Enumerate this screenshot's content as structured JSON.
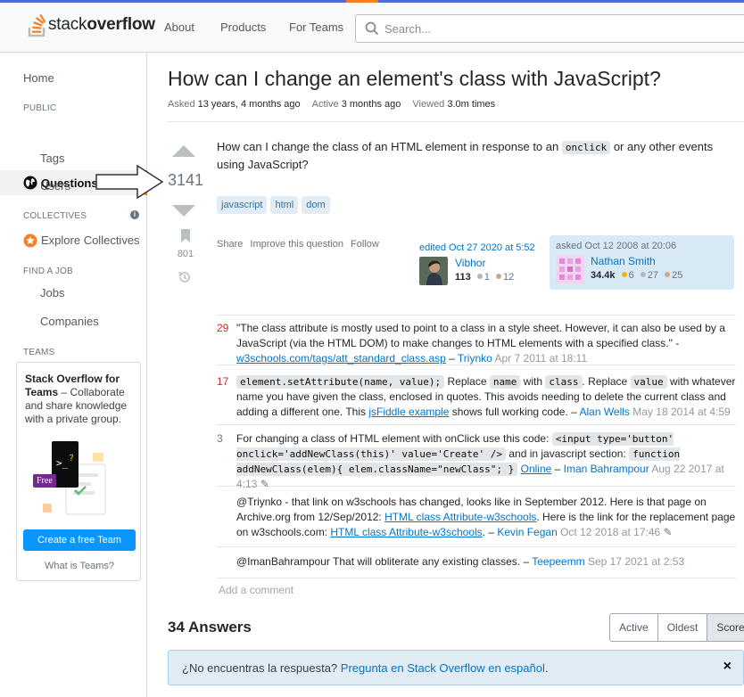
{
  "header": {
    "logo": {
      "part1": "stack",
      "part2": "overflow"
    },
    "nav": [
      "About",
      "Products",
      "For Teams"
    ],
    "search_placeholder": "Search..."
  },
  "sidebar": {
    "home": "Home",
    "public_heading": "PUBLIC",
    "questions": "Questions",
    "tags": "Tags",
    "users": "Users",
    "collectives_heading": "COLLECTIVES",
    "explore_collectives": "Explore Collectives",
    "find_job_heading": "FIND A JOB",
    "jobs": "Jobs",
    "companies": "Companies",
    "teams_heading": "TEAMS",
    "promo": {
      "title": "Stack Overflow for Teams",
      "text": " – Collaborate and share knowledge with a private group.",
      "free_label": "Free",
      "button": "Create a free Team",
      "link": "What is Teams?"
    }
  },
  "question": {
    "title": "How can I change an element's class with JavaScript?",
    "asked_label": "Asked",
    "asked_value": "13 years, 4 months ago",
    "active_label": "Active",
    "active_value": "3 months ago",
    "viewed_label": "Viewed",
    "viewed_value": "3.0m times",
    "votes": "3141",
    "bookmarks": "801",
    "body_before": "How can I change the class of an HTML element in response to an ",
    "body_code": "onclick",
    "body_after": " or any other events using JavaScript?",
    "tags": [
      "javascript",
      "html",
      "dom"
    ],
    "menu": [
      "Share",
      "Improve this question",
      "Follow"
    ],
    "edited": {
      "when": "edited Oct 27 2020 at 5:52",
      "user": "Vibhor",
      "rep": "113",
      "silver": "1",
      "bronze": "12"
    },
    "asked": {
      "when": "asked Oct 12 2008 at 20:06",
      "user": "Nathan Smith",
      "rep": "34.4k",
      "gold": "6",
      "silver": "27",
      "bronze": "25"
    }
  },
  "comments": [
    {
      "score": "29",
      "text": "\"The class attribute is mostly used to point to a class in a style sheet. However, it can also be used by a JavaScript (via the HTML DOM) to make changes to HTML elements with a specified class.\" - ",
      "link": "w3schools.com/tags/att_standard_class.asp",
      "sep": " – ",
      "user": "Triynko",
      "date": "Apr 7 2011 at 18:11"
    },
    {
      "score": "17",
      "code1": "element.setAttribute(name, value);",
      "t1": " Replace ",
      "code2": "name",
      "t2": " with ",
      "code3": "class",
      "t3": ". Replace ",
      "code4": "value",
      "t4": " with whatever name you have given the class, enclosed in quotes. This avoids needing to delete the current class and adding a different one. This ",
      "link": "jsFiddle example",
      "t5": " shows full working code. – ",
      "user": "Alan Wells",
      "date": "May 18 2014 at 4:59"
    },
    {
      "score": "3",
      "t1": "For changing a class of HTML element with onClick use this code: ",
      "code1": "<input type='button' onclick='addNewClass(this)' value='Create' />",
      "t2": " and in javascript section: ",
      "code2": "function addNewClass(elem){    elem.className=\"newClass\"; }",
      "t3": " ",
      "link": "Online",
      "sep": " – ",
      "user": "Iman Bahrampour",
      "date": "Aug 22 2017 at 4:13"
    },
    {
      "score": "",
      "t1": "@Triynko - that link on w3schools has changed, looks like in September 2012. Here is that page on Archive.org from 12/Sep/2012: ",
      "link1": "HTML class Attribute-w3schools",
      "t2": ". Here is the link for the replacement page on w3schools.com: ",
      "link2": "HTML class Attribute-w3schools",
      "t3": ". – ",
      "user": "Kevin Fegan",
      "date": "Oct 12 2018 at 17:46"
    },
    {
      "score": "",
      "t1": "@ImanBahrampour That will obliterate any existing classes. – ",
      "user": "Teepeemm",
      "date": "Sep 17 2021 at 2:53"
    }
  ],
  "add_comment": "Add a comment",
  "answers": {
    "count_label": "34 Answers",
    "sort": [
      "Active",
      "Oldest",
      "Score"
    ]
  },
  "banner": {
    "text": "¿No encuentras la respuesta? ",
    "link": "Pregunta en Stack Overflow en español",
    "after": ".",
    "close": "×"
  },
  "colors": {
    "accent": "#f48225",
    "link": "#0074cc",
    "tag_bg": "#e1ecf4",
    "button": "#0a95ff",
    "gold": "#f1b600",
    "silver": "#b4b8bc",
    "bronze": "#d1a684"
  }
}
